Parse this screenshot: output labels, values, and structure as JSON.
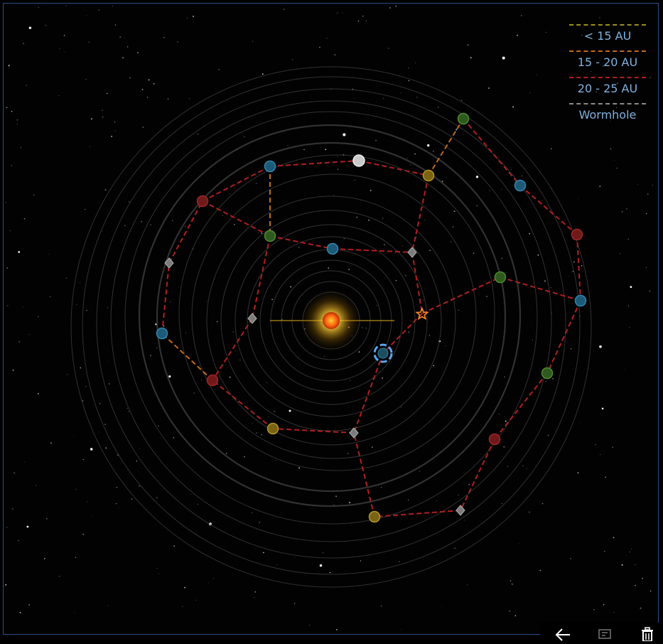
{
  "legend": {
    "items": [
      {
        "label": "< 15 AU",
        "color": "#9a8f1c"
      },
      {
        "label": "15 - 20 AU",
        "color": "#c46a1c"
      },
      {
        "label": "20 - 25 AU",
        "color": "#b21f1f"
      },
      {
        "label": "Wormhole",
        "color": "#8a8a8a"
      }
    ]
  },
  "colors": {
    "background": "#000000",
    "frame_border": "#2a4f84",
    "orbit": "#3a3a3a",
    "route_red": "#b21f1f",
    "route_orange": "#c46a1c",
    "planet_blue": "#1d5a78",
    "planet_green": "#2f5a1f",
    "planet_red": "#6e1a1a",
    "planet_yellow": "#7a6414",
    "wormhole": "#7c7c7c",
    "selection": "#5aa6f0",
    "star_marker": "#ff8c1a"
  },
  "toolbar": {
    "buttons": [
      {
        "name": "back-arrow-icon"
      },
      {
        "name": "card-icon"
      },
      {
        "name": "trash-icon"
      }
    ]
  }
}
